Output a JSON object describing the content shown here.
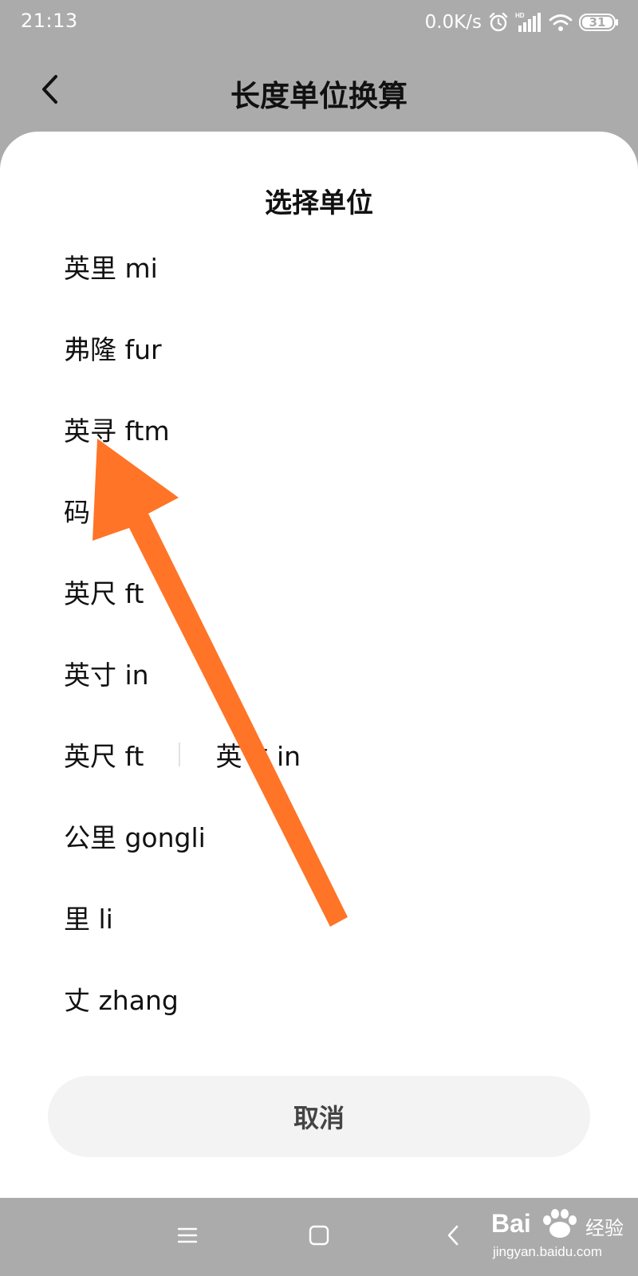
{
  "status_bar": {
    "time": "21:13",
    "net_speed": "0.0K/s",
    "battery": "31",
    "icons": [
      "alarm-icon",
      "hd-signal-icon",
      "wifi-icon",
      "battery-icon"
    ]
  },
  "header": {
    "title": "长度单位换算",
    "back_icon": "chevron-left-icon"
  },
  "sheet": {
    "title": "选择单位",
    "units": [
      {
        "label": "英里 mi"
      },
      {
        "label": "弗隆 fur"
      },
      {
        "label": "英寻 ftm"
      },
      {
        "label": "码"
      },
      {
        "label": "英尺 ft"
      },
      {
        "label": "英寸 in"
      },
      {
        "label": "英尺 ft",
        "label2": "英寸 in"
      },
      {
        "label": "公里 gongli"
      },
      {
        "label": "里 li"
      },
      {
        "label": "丈 zhang"
      }
    ],
    "cancel_label": "取消"
  },
  "nav_bar": {
    "icons": [
      "menu-icon",
      "home-square-icon",
      "back-icon"
    ]
  },
  "watermark": {
    "brand": "Bai",
    "brand_cn": "经验",
    "url": "jingyan.baidu.com"
  },
  "colors": {
    "annotation_arrow": "#ff7427",
    "dim_background": "#ababab",
    "sheet_background": "#ffffff",
    "cancel_background": "#f3f3f3"
  }
}
